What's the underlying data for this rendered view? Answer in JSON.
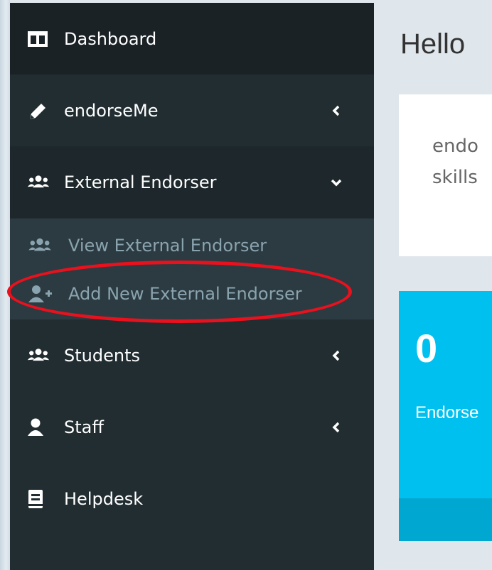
{
  "sidebar": {
    "items": [
      {
        "label": "Dashboard",
        "icon": "columns-icon"
      },
      {
        "label": "endorseMe",
        "icon": "pencil-icon"
      },
      {
        "label": "External Endorser",
        "icon": "users-icon"
      },
      {
        "label": "Students",
        "icon": "users-icon"
      },
      {
        "label": "Staff",
        "icon": "user-icon"
      },
      {
        "label": "Helpdesk",
        "icon": "book-icon"
      }
    ],
    "submenu": [
      {
        "label": "View External Endorser",
        "icon": "users-icon"
      },
      {
        "label": "Add New External Endorser",
        "icon": "user-plus-icon"
      }
    ]
  },
  "main": {
    "greeting": "Hello",
    "card_lines": [
      "endo",
      "skills"
    ],
    "tile": {
      "value": "0",
      "caption": "Endorse"
    }
  },
  "colors": {
    "sidebar_bg": "#222d32",
    "submenu_bg": "#2c3b41",
    "tile_bg": "#00c0ef",
    "annotation": "#e8111d"
  }
}
